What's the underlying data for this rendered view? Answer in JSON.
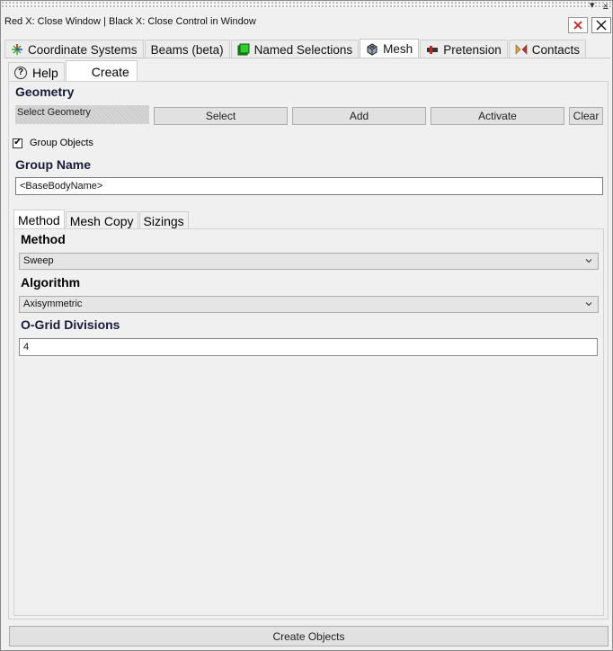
{
  "window": {
    "hint": "Red X: Close Window | Black X: Close Control in Window",
    "pin_glyph": "▾",
    "pin2_glyph": "⨱",
    "close_red_icon": "close-red-icon",
    "close_black_icon": "close-black-icon",
    "colors": {
      "close_red": "#d81e1e",
      "panel_bg": "#f0f0f0",
      "title_text": "#1a1a3a"
    }
  },
  "top_tabs": [
    {
      "label": "Coordinate Systems",
      "icon": "coordinate-icon"
    },
    {
      "label": "Beams (beta)",
      "icon": ""
    },
    {
      "label": "Named Selections",
      "icon": "named-selection-icon"
    },
    {
      "label": "Mesh",
      "icon": "mesh-icon",
      "active": true
    },
    {
      "label": "Pretension",
      "icon": "pretension-icon"
    },
    {
      "label": "Contacts",
      "icon": "contacts-icon"
    }
  ],
  "sub_tabs": {
    "help": "Help",
    "create": "Create"
  },
  "geometry": {
    "title": "Geometry",
    "select_geometry": "Select Geometry",
    "select": "Select",
    "add": "Add",
    "activate": "Activate",
    "clear": "Clear"
  },
  "group": {
    "checkbox_label": "Group Objects",
    "checked_glyph": "✔",
    "name_title": "Group Name",
    "name_value": "<BaseBodyName>"
  },
  "inner_tabs": {
    "method": "Method",
    "mesh_copy": "Mesh Copy",
    "sizings": "Sizings"
  },
  "method": {
    "title": "Method",
    "value": "Sweep",
    "algorithm_title": "Algorithm",
    "algorithm_value": "Axisymmetric",
    "ogrid_title": "O-Grid Divisions",
    "ogrid_value": "4"
  },
  "footer": {
    "create": "Create Objects"
  }
}
